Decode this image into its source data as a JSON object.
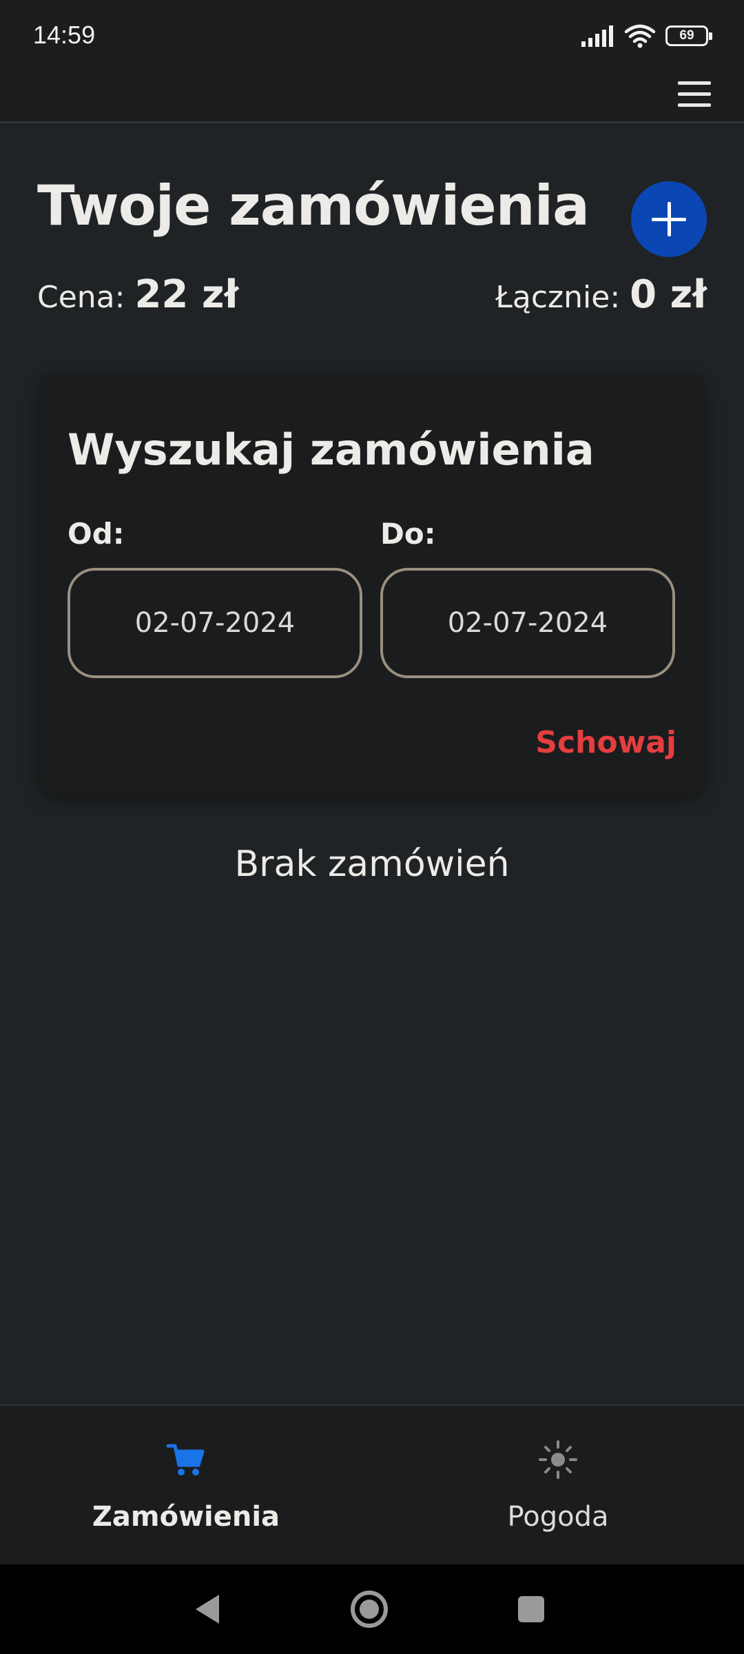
{
  "status_bar": {
    "time": "14:59",
    "battery": "69"
  },
  "header": {
    "title": "Twoje zamówienia",
    "add_icon": "plus-icon"
  },
  "summary": {
    "price_label": "Cena: ",
    "price_value": "22 zł",
    "total_label": "Łącznie: ",
    "total_value": "0 zł"
  },
  "search": {
    "title": "Wyszukaj zamówienia",
    "from_label": "Od:",
    "from_value": "02-07-2024",
    "to_label": "Do:",
    "to_value": "02-07-2024",
    "hide_label": "Schowaj"
  },
  "empty_message": "Brak zamówień",
  "bottom_nav": {
    "items": [
      {
        "label": "Zamówienia",
        "icon": "cart-icon",
        "active": true
      },
      {
        "label": "Pogoda",
        "icon": "sun-icon",
        "active": false
      }
    ]
  },
  "colors": {
    "background": "#202325",
    "accent": "#0a47b4",
    "active_tab": "#1a73e8",
    "danger": "#e53e3e",
    "field_border": "#9a8f80"
  }
}
